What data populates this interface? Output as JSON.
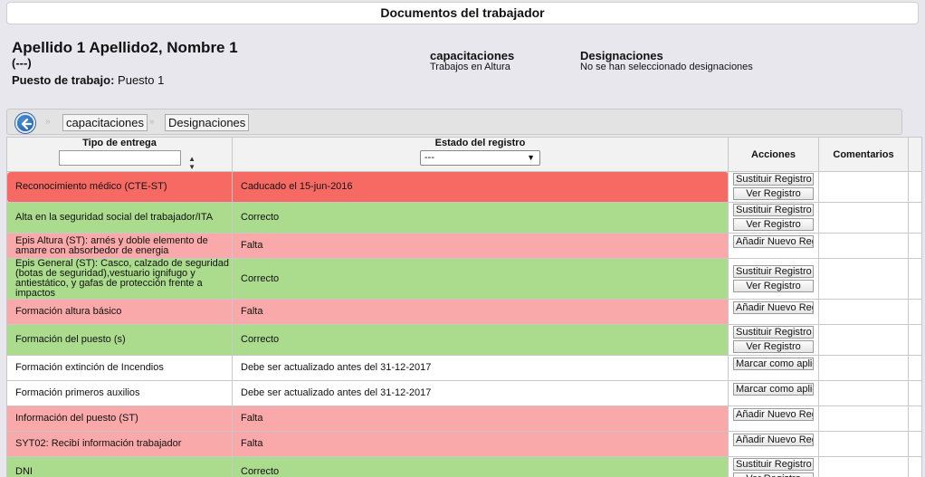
{
  "title": "Documentos del trabajador",
  "worker": {
    "name": "Apellido 1 Apellido2, Nombre 1",
    "subtitle": "(---)",
    "puesto_label": "Puesto de trabajo:",
    "puesto_value": "Puesto 1"
  },
  "capacitaciones": {
    "heading": "capacitaciones",
    "text": "Trabajos en Altura"
  },
  "designaciones": {
    "heading": "Designaciones",
    "text": "No se han seleccionado designaciones"
  },
  "toolbar": {
    "sep": "»",
    "capacitaciones_btn": "capacitaciones",
    "designaciones_btn": "Designaciones"
  },
  "columns": {
    "tipo": "Tipo de entrega",
    "estado": "Estado del registro",
    "estado_select": "---",
    "acciones": "Acciones",
    "comentarios": "Comentarios"
  },
  "rows": [
    {
      "tipo": "Reconocimiento médico (CTE-ST)",
      "estado": "Caducado el 15-jun-2016",
      "status": "red",
      "actions": [
        "Sustituir Registro",
        "Ver Registro"
      ]
    },
    {
      "tipo": "Alta en la seguridad social del trabajador/ITA",
      "estado": "Correcto",
      "status": "green",
      "actions": [
        "Sustituir Registro",
        "Ver Registro"
      ]
    },
    {
      "tipo": "Epis Altura (ST): arnés y doble elemento de amarre con absorbedor de energia",
      "estado": "Falta",
      "status": "pink",
      "actions": [
        "Añadir Nuevo Registro"
      ]
    },
    {
      "tipo": "Epis General (ST): Casco, calzado de seguridad (botas de seguridad),vestuario ignifugo y antiestático, y gafas de protección frente a impactos",
      "estado": "Correcto",
      "status": "green",
      "actions": [
        "Sustituir Registro",
        "Ver Registro"
      ]
    },
    {
      "tipo": "Formación altura básico",
      "estado": "Falta",
      "status": "pink",
      "actions": [
        "Añadir Nuevo Registro"
      ]
    },
    {
      "tipo": "Formación del puesto (s)",
      "estado": "Correcto",
      "status": "green",
      "actions": [
        "Sustituir Registro",
        "Ver Registro"
      ]
    },
    {
      "tipo": "Formación extinción de Incendios",
      "estado": "Debe ser actualizado antes del 31-12-2017",
      "status": "white",
      "actions": [
        "Marcar como aplica"
      ]
    },
    {
      "tipo": "Formación primeros auxilios",
      "estado": "Debe ser actualizado antes del 31-12-2017",
      "status": "white",
      "actions": [
        "Marcar como aplica"
      ]
    },
    {
      "tipo": "Información del puesto (ST)",
      "estado": "Falta",
      "status": "pink",
      "actions": [
        "Añadir Nuevo Registro"
      ]
    },
    {
      "tipo": "SYT02: Recibí información trabajador",
      "estado": "Falta",
      "status": "pink",
      "actions": [
        "Añadir Nuevo Registro"
      ]
    },
    {
      "tipo": "DNI",
      "estado": "Correcto",
      "status": "green",
      "actions": [
        "Sustituir Registro",
        "Ver Registro"
      ]
    }
  ],
  "colors": {
    "red": "#f76a64",
    "pink": "#f9a9a9",
    "green": "#abdb8d",
    "background": "#e9e7ee"
  }
}
